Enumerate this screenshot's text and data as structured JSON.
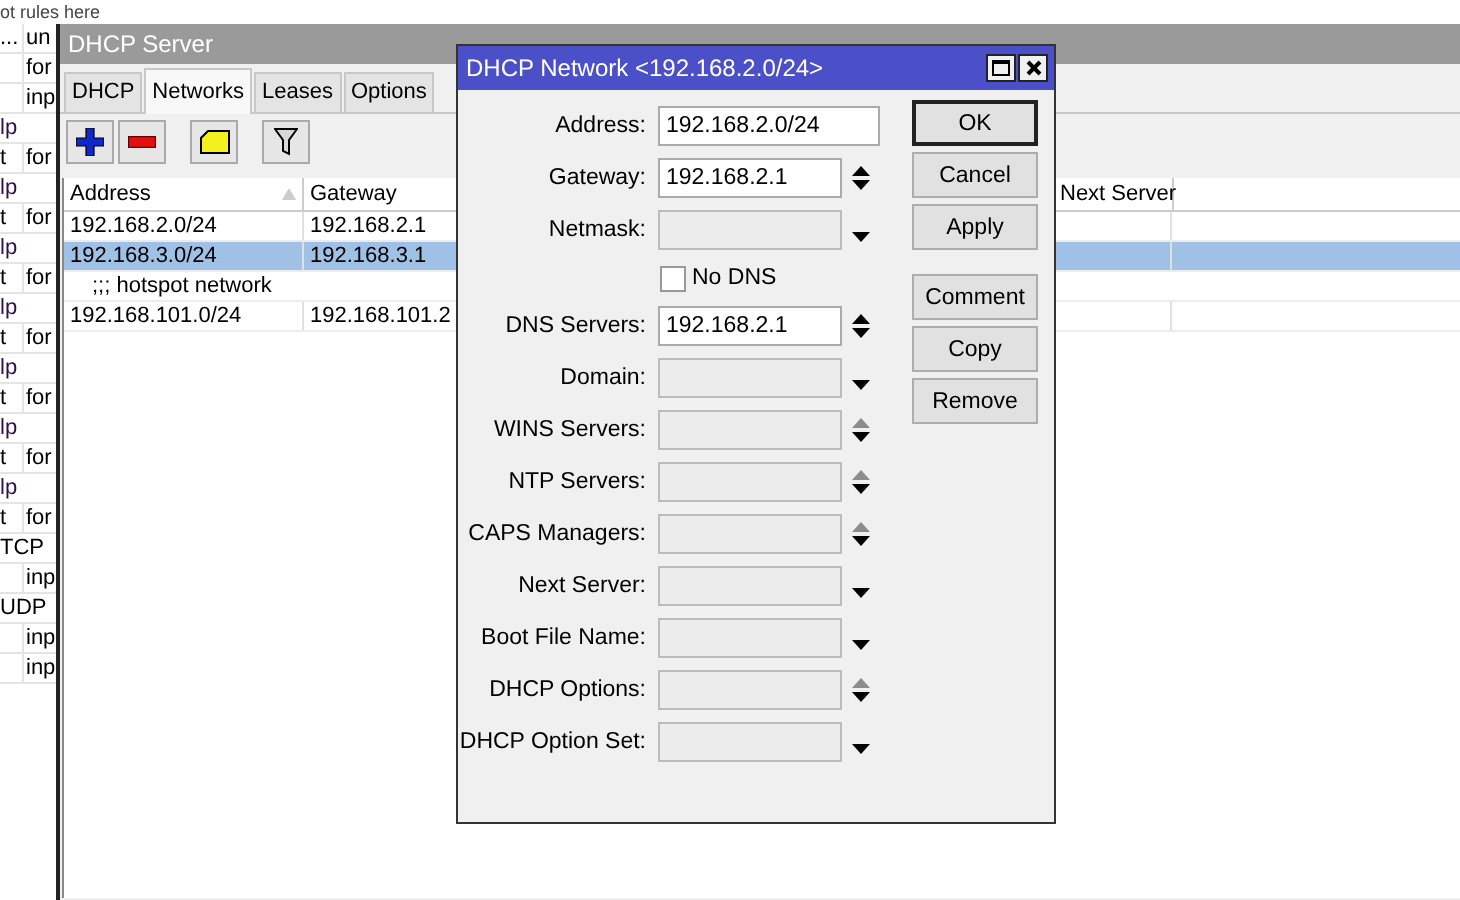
{
  "background_list": {
    "header": "ot rules here",
    "rows": [
      {
        "col_1": "...",
        "col_2": "un"
      },
      {
        "col_1": "",
        "col_2": "for"
      },
      {
        "col_1": "",
        "col_2": "inp"
      },
      {
        "col_1": "lp"
      },
      {
        "col_1": "t",
        "col_2": "for"
      },
      {
        "col_1": "lp"
      },
      {
        "col_1": "t",
        "col_2": "for"
      },
      {
        "col_1": "lp"
      },
      {
        "col_1": "t",
        "col_2": "for"
      },
      {
        "col_1": "lp"
      },
      {
        "col_1": "t",
        "col_2": "for"
      },
      {
        "col_1": "lp"
      },
      {
        "col_1": "t",
        "col_2": "for"
      },
      {
        "col_1": "lp"
      },
      {
        "col_1": "t",
        "col_2": "for"
      },
      {
        "col_1": "lp"
      },
      {
        "col_1": "t",
        "col_2": "for"
      },
      {
        "col_1": "TCP"
      },
      {
        "col_1": "",
        "col_2": "inp"
      },
      {
        "col_1": "UDP"
      },
      {
        "col_1": "",
        "col_2": "inp"
      },
      {
        "col_1": "",
        "col_2": "inp"
      }
    ]
  },
  "dhcp_server": {
    "title": "DHCP Server",
    "tabs": [
      {
        "label": "DHCP",
        "selected": false
      },
      {
        "label": "Networks",
        "selected": true
      },
      {
        "label": "Leases",
        "selected": false
      },
      {
        "label": "Options",
        "selected": false
      }
    ],
    "table": {
      "columns": [
        "Address",
        "Gateway",
        "Next Server"
      ],
      "rows": [
        {
          "kind": "entry",
          "address": "192.168.2.0/24",
          "gateway": "192.168.2.1",
          "selected": false
        },
        {
          "kind": "entry",
          "address": "192.168.3.0/24",
          "gateway": "192.168.3.1",
          "selected": true
        },
        {
          "kind": "comment",
          "text": ";;; hotspot network"
        },
        {
          "kind": "entry",
          "address": "192.168.101.0/24",
          "gateway": "192.168.101.2",
          "selected": false
        }
      ]
    }
  },
  "dialog": {
    "title": "DHCP Network <192.168.2.0/24>",
    "fields": [
      {
        "kind": "text",
        "label": "Address:",
        "value": "192.168.2.0/24",
        "unset": false
      },
      {
        "kind": "spin",
        "label": "Gateway:",
        "value": "192.168.2.1",
        "unset": false,
        "up_enabled": true
      },
      {
        "kind": "dropdown",
        "label": "Netmask:",
        "unset": true
      },
      {
        "kind": "checkbox",
        "label": "No DNS",
        "checked": false
      },
      {
        "kind": "spin",
        "label": "DNS Servers:",
        "value": "192.168.2.1",
        "unset": false,
        "up_enabled": true
      },
      {
        "kind": "dropdown",
        "label": "Domain:",
        "unset": true
      },
      {
        "kind": "spin",
        "label": "WINS Servers:",
        "unset": true,
        "up_enabled": false
      },
      {
        "kind": "spin",
        "label": "NTP Servers:",
        "unset": true,
        "up_enabled": false
      },
      {
        "kind": "spin",
        "label": "CAPS Managers:",
        "unset": true,
        "up_enabled": false
      },
      {
        "kind": "dropdown",
        "label": "Next Server:",
        "unset": true
      },
      {
        "kind": "dropdown",
        "label": "Boot File Name:",
        "unset": true
      },
      {
        "kind": "spin",
        "label": "DHCP Options:",
        "unset": true,
        "up_enabled": false
      },
      {
        "kind": "dropdown",
        "label": "DHCP Option Set:",
        "unset": true
      }
    ],
    "button_groups": [
      {
        "buttons": [
          {
            "label": "OK",
            "default": true
          },
          {
            "label": "Cancel",
            "default": false
          },
          {
            "label": "Apply",
            "default": false
          }
        ]
      },
      {
        "buttons": [
          {
            "label": "Comment",
            "default": false
          },
          {
            "label": "Copy",
            "default": false
          },
          {
            "label": "Remove",
            "default": false
          }
        ]
      }
    ]
  }
}
